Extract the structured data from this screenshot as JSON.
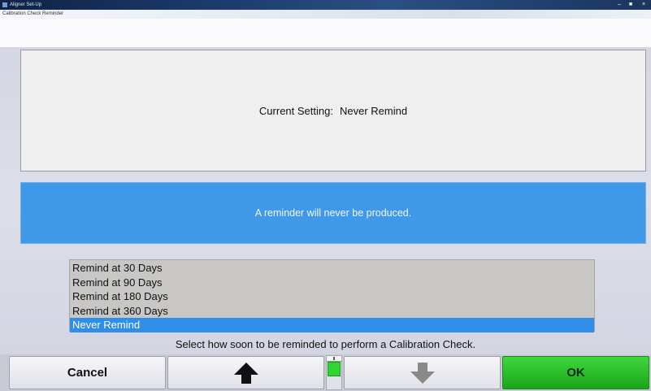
{
  "window": {
    "title": "Aligner Set-Up",
    "subtitle": "Calibration Check Reminder",
    "minimize_glyph": "–",
    "maximize_glyph": "■",
    "close_glyph": "×"
  },
  "current_setting": {
    "label": "Current Setting:",
    "value": "Never Remind"
  },
  "info": {
    "message": "A reminder will never be produced."
  },
  "options": {
    "items": [
      {
        "label": "Remind at 30 Days",
        "selected": false
      },
      {
        "label": "Remind at 90 Days",
        "selected": false
      },
      {
        "label": "Remind at 180 Days",
        "selected": false
      },
      {
        "label": "Remind at 360 Days",
        "selected": false
      },
      {
        "label": "Never Remind",
        "selected": true
      }
    ],
    "selected_color": "#2f8fe8"
  },
  "hint": "Select how soon to be reminded to perform a Calibration Check.",
  "buttons": {
    "cancel": "Cancel",
    "up_icon": "arrow-up-icon",
    "down_icon": "arrow-down-icon",
    "ok": "OK"
  },
  "colors": {
    "info_panel": "#3f98e8",
    "ok_button": "#2ec72e",
    "indicator": "#2fd62f"
  }
}
